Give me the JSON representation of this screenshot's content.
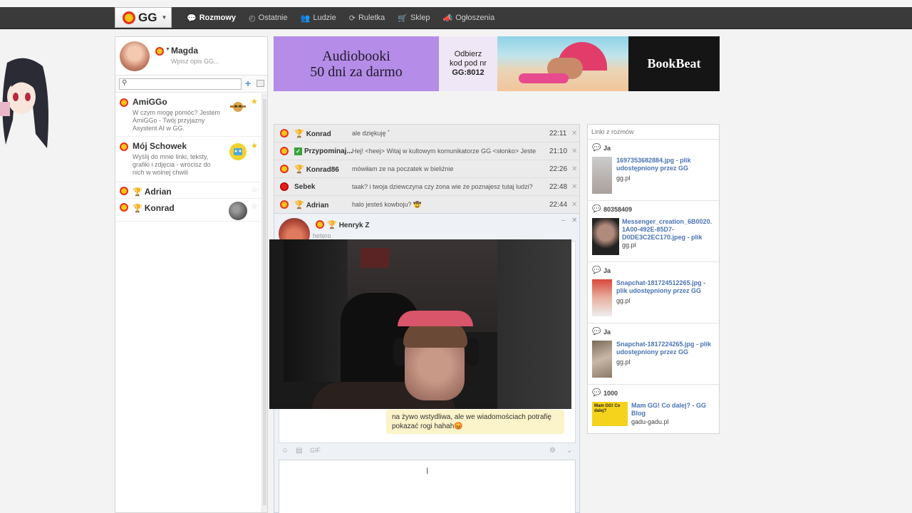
{
  "nav": {
    "logo": "GG",
    "items": [
      {
        "label": "Rozmowy",
        "icon": "chat-bubbles-icon",
        "active": true
      },
      {
        "label": "Ostatnie",
        "icon": "clock-icon"
      },
      {
        "label": "Ludzie",
        "icon": "people-icon"
      },
      {
        "label": "Ruletka",
        "icon": "roulette-icon"
      },
      {
        "label": "Sklep",
        "icon": "cart-icon"
      },
      {
        "label": "Ogłoszenia",
        "icon": "megaphone-icon"
      }
    ]
  },
  "profile": {
    "name": "Magda",
    "description_placeholder": "Wpisz opis GG..."
  },
  "contacts": [
    {
      "name": "AmiGGo",
      "desc": "W czym mogę pomóc? Jestem AmiGGo - Twój przyjazny Asystent AI w GG.",
      "starred": true
    },
    {
      "name": "Mój Schowek",
      "desc": "Wyślij do mnie linki, teksty, grafiki i zdjęcia - wrócisz do nich w wolnej chwili",
      "starred": true
    },
    {
      "name": "Adrian",
      "desc": "",
      "starred": false
    },
    {
      "name": "Konrad",
      "desc": "",
      "starred": false
    }
  ],
  "banner": {
    "headline_line1": "Audiobooki",
    "headline_line2": "50 dni za darmo",
    "promo_line1": "Odbierz",
    "promo_line2": "kod pod nr",
    "promo_code": "GG:8012",
    "brand": "BookBeat"
  },
  "conversations": [
    {
      "name": "Konrad",
      "message": "ale dziękuję ˚",
      "time": "22:11"
    },
    {
      "name": "Przypominaj...",
      "message": "Hej! <heej> Witaj w kultowym komunikatorze GG <słonko> Jeste",
      "time": "21:10"
    },
    {
      "name": "Konrad86",
      "message": "mówiłam ze na poczatek w bieliźnie",
      "time": "22:26"
    },
    {
      "name": "Sebek",
      "message": "taak? i twoja dziewczyna czy żona wie że poznajesz tutaj ludzi?",
      "time": "22:48"
    },
    {
      "name": "Adrian",
      "message": "halo jesteś kowboju? 🤠",
      "time": "22:44"
    }
  ],
  "chat": {
    "name": "Henryk Z",
    "description": "hetero",
    "last_message": "na żywo wstydliwa, ale we wiadomościach potrafię pokazać rogi hahah😡",
    "gif_label": "GIF"
  },
  "links_panel": {
    "title": "Linki z rozmów",
    "items": [
      {
        "from": "Ja",
        "title": "1697353682884.jpg - plik udostępniony przez GG",
        "domain": "gg.pl"
      },
      {
        "from": "80358409",
        "title": "Messenger_creation_6B0020. 1A00-492E-85D7-D0DE3C2EC170.jpeg - plik",
        "domain": "gg.pl"
      },
      {
        "from": "Ja",
        "title": "Snapchat-181724512265.jpg - plik udostępniony przez GG",
        "domain": "gg.pl"
      },
      {
        "from": "Ja",
        "title": "Snapchat-1817224265.jpg - plik udostępniony przez GG",
        "domain": "gg.pl"
      },
      {
        "from": "1000",
        "title": "Mam GG! Co dalej? - GG Blog",
        "domain": "gadu-gadu.pl",
        "thumb_text": "Mam GG! Co dalej?"
      }
    ]
  },
  "colors": {
    "topbar": "#3a3a3a",
    "link": "#4a73b3",
    "banner_purple": "#b58ce8",
    "bubble": "#fbf3c9"
  }
}
